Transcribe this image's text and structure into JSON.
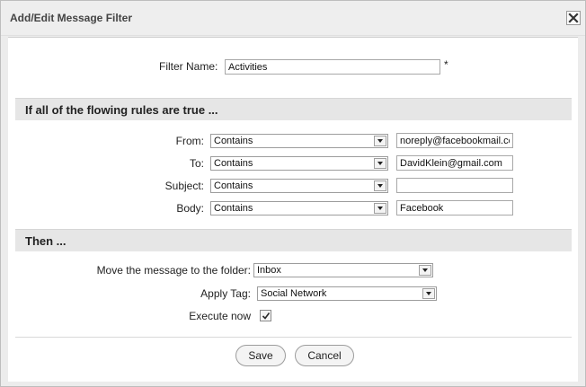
{
  "dialog": {
    "title": "Add/Edit Message Filter",
    "close_icon": "close-icon"
  },
  "filter": {
    "name_label": "Filter Name:",
    "name_value": "Activities",
    "required_mark": "*"
  },
  "conditions": {
    "header": "If all of the flowing rules are true ...",
    "rules": [
      {
        "label": "From:",
        "operator": "Contains",
        "value": "noreply@facebookmail.com"
      },
      {
        "label": "To:",
        "operator": "Contains",
        "value": "DavidKlein@gmail.com"
      },
      {
        "label": "Subject:",
        "operator": "Contains",
        "value": ""
      },
      {
        "label": "Body:",
        "operator": "Contains",
        "value": "Facebook"
      }
    ]
  },
  "actions": {
    "header": "Then ...",
    "move_label": "Move the message to the folder:",
    "move_value": "Inbox",
    "tag_label": "Apply Tag:",
    "tag_value": "Social Network",
    "execute_label": "Execute now",
    "execute_checked": true
  },
  "buttons": {
    "save": "Save",
    "cancel": "Cancel"
  }
}
